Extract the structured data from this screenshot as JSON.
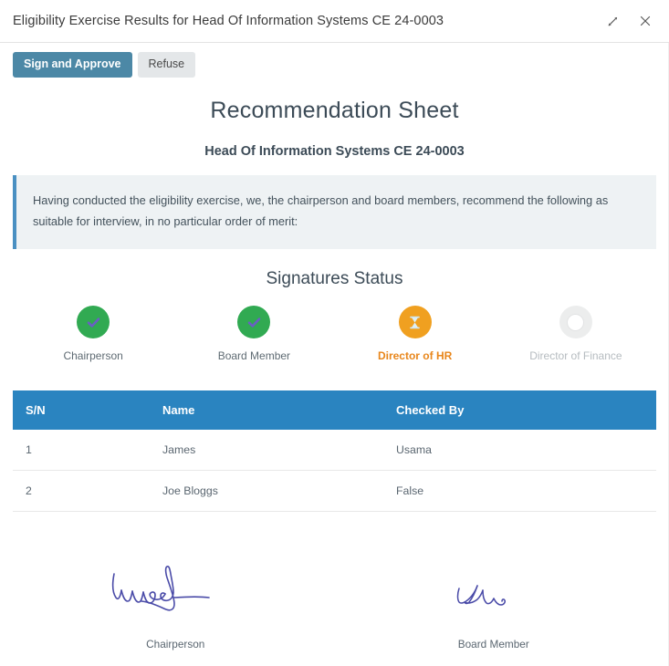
{
  "window": {
    "title": "Eligibility Exercise Results for Head Of Information Systems CE 24-0003",
    "controls": [
      {
        "name": "expand-icon",
        "label": "Expand"
      },
      {
        "name": "close-icon",
        "label": "Close"
      }
    ]
  },
  "toolbar": {
    "sign_approve_label": "Sign and Approve",
    "refuse_label": "Refuse"
  },
  "document": {
    "title": "Recommendation Sheet",
    "subtitle": "Head Of Information Systems CE 24-0003",
    "banner_text": "Having conducted the eligibility exercise, we, the chairperson and board members, recommend the following as suitable for interview, in no particular order of merit:"
  },
  "signatures_status": {
    "heading": "Signatures Status",
    "items": [
      {
        "label": "Chairperson",
        "state": "signed",
        "icon": "check-icon"
      },
      {
        "label": "Board Member",
        "state": "signed",
        "icon": "check-icon"
      },
      {
        "label": "Director of HR",
        "state": "pending",
        "icon": "hourglass-icon"
      },
      {
        "label": "Director of Finance",
        "state": "empty",
        "icon": "circle-outline-icon"
      }
    ]
  },
  "table": {
    "columns": [
      "S/N",
      "Name",
      "Checked By"
    ],
    "rows": [
      {
        "sn": "1",
        "name": "James",
        "checked_by": "Usama"
      },
      {
        "sn": "2",
        "name": "Joe Bloggs",
        "checked_by": "False"
      }
    ]
  },
  "signature_blocks": [
    {
      "role": "Chairperson"
    },
    {
      "role": "Board Member"
    }
  ],
  "colors": {
    "primary_button": "#4c88a6",
    "table_header": "#2a84c0",
    "banner_border": "#4a90c2",
    "signed": "#31aa52",
    "pending": "#f0a020",
    "empty": "#eceded",
    "ink": "#4a4ba8"
  }
}
